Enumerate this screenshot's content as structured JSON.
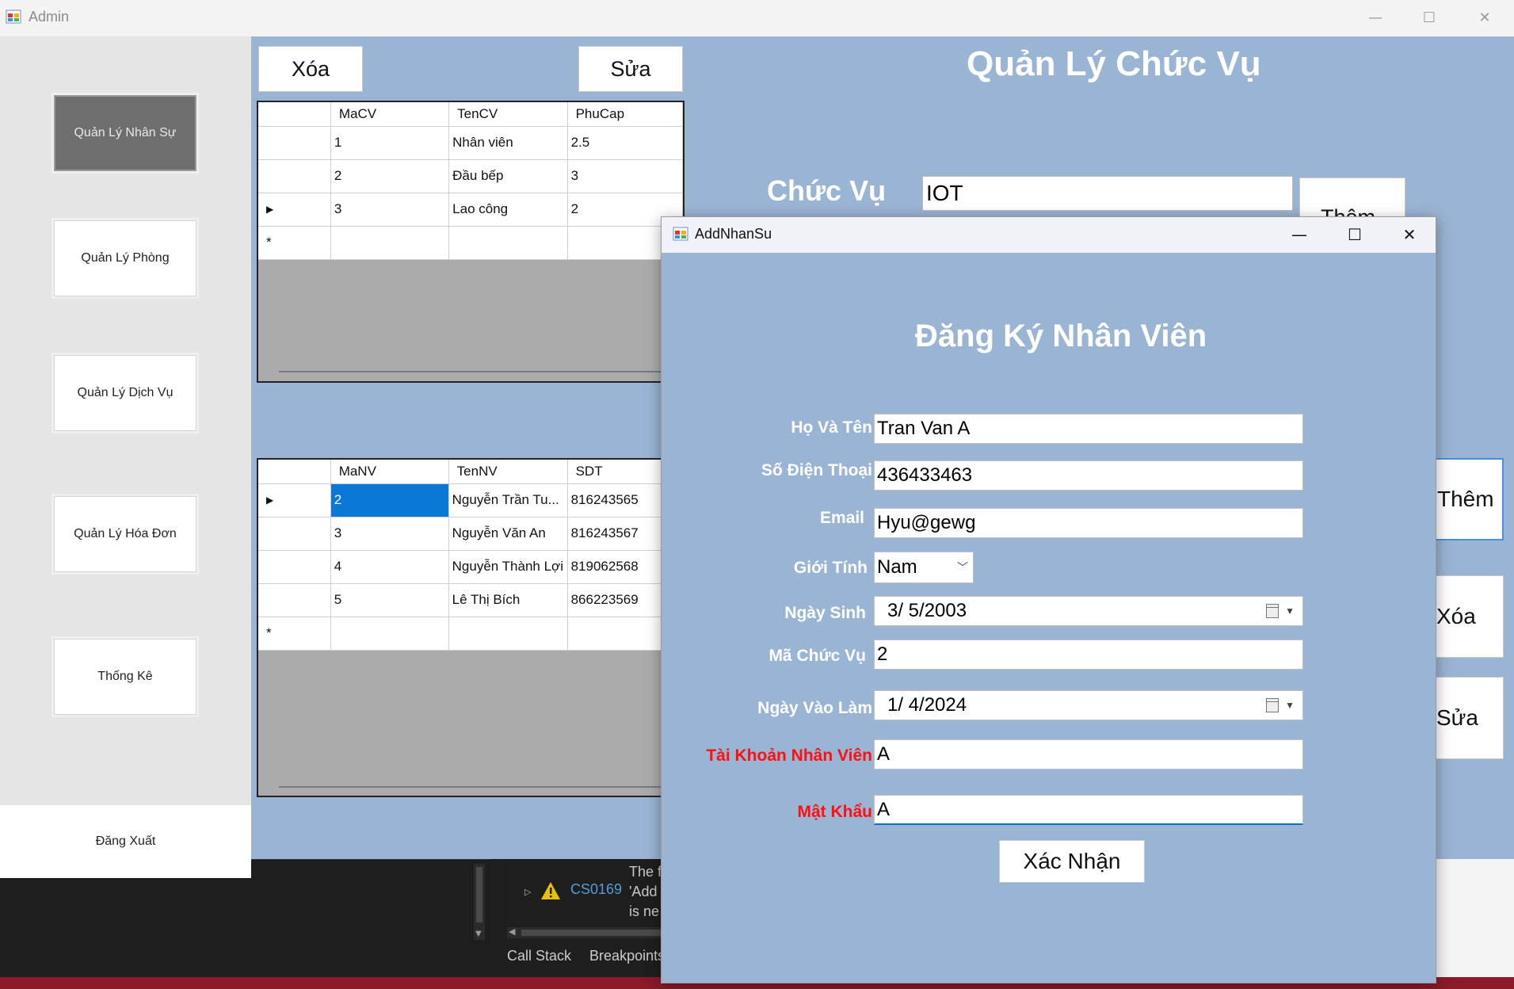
{
  "admin": {
    "title": "Admin",
    "controls": {
      "minimize": "—",
      "maximize": "☐",
      "close": "✕"
    },
    "sidebar": {
      "items": [
        {
          "label": "Quản Lý Nhân Sự",
          "active": true
        },
        {
          "label": "Quản Lý Phòng"
        },
        {
          "label": "Quản Lý Dịch Vụ"
        },
        {
          "label": "Quản Lý Hóa Đơn"
        },
        {
          "label": "Thống Kê"
        }
      ],
      "logout": "Đăng Xuất"
    },
    "toolbar": {
      "delete": "Xóa",
      "edit": "Sửa"
    },
    "page_title": "Quản Lý Chức Vụ",
    "chucvu": {
      "label": "Chức Vụ",
      "value": "IOT",
      "add": "Thêm"
    },
    "right_buttons": {
      "add": "Thêm",
      "delete": "Xóa",
      "edit": "Sửa"
    },
    "grid_positions": {
      "columns": [
        "MaCV",
        "TenCV",
        "PhuCap"
      ],
      "rows": [
        [
          "1",
          "Nhân viên",
          "2.5"
        ],
        [
          "2",
          "Đầu bếp",
          "3"
        ],
        [
          "3",
          "Lao công",
          "2"
        ]
      ],
      "current_row_marker": "▶",
      "new_row_marker": "*"
    },
    "grid_employees": {
      "columns": [
        "MaNV",
        "TenNV",
        "SDT"
      ],
      "rows": [
        [
          "2",
          "Nguyễn Trần Tu...",
          "816243565"
        ],
        [
          "3",
          "Nguyễn Văn An",
          "816243567"
        ],
        [
          "4",
          "Nguyễn Thành Lợi",
          "819062568"
        ],
        [
          "5",
          "Lê Thị Bích",
          "866223569"
        ]
      ],
      "current_row_marker": "▶",
      "new_row_marker": "*"
    }
  },
  "ide": {
    "error_code": "CS0169",
    "error_text": "The f\n'Add\nis ne",
    "tabs": [
      "Call Stack",
      "Breakpoints"
    ]
  },
  "dialog": {
    "title": "AddNhanSu",
    "controls": {
      "minimize": "—",
      "maximize": "☐",
      "close": "✕"
    },
    "heading": "Đăng Ký Nhân Viên",
    "fields": {
      "fullname": {
        "label": "Họ Và Tên",
        "value": "Tran Van A"
      },
      "phone": {
        "label": "Số Điện Thoại",
        "value": "436433463"
      },
      "email": {
        "label": "Email",
        "value": "Hyu@gewg"
      },
      "gender": {
        "label": "Giới Tính",
        "value": "Nam"
      },
      "birthdate": {
        "label": "Ngày Sinh",
        "value": "3/  5/2003"
      },
      "position_id": {
        "label": "Mã Chức Vụ",
        "value": "2"
      },
      "start_date": {
        "label": "Ngày Vào Làm",
        "value": "1/  4/2024"
      },
      "account": {
        "label": "Tài Khoản Nhân Viên",
        "value": "A"
      },
      "password": {
        "label": "Mật Khẩu",
        "value": "A"
      }
    },
    "confirm": "Xác Nhận"
  }
}
